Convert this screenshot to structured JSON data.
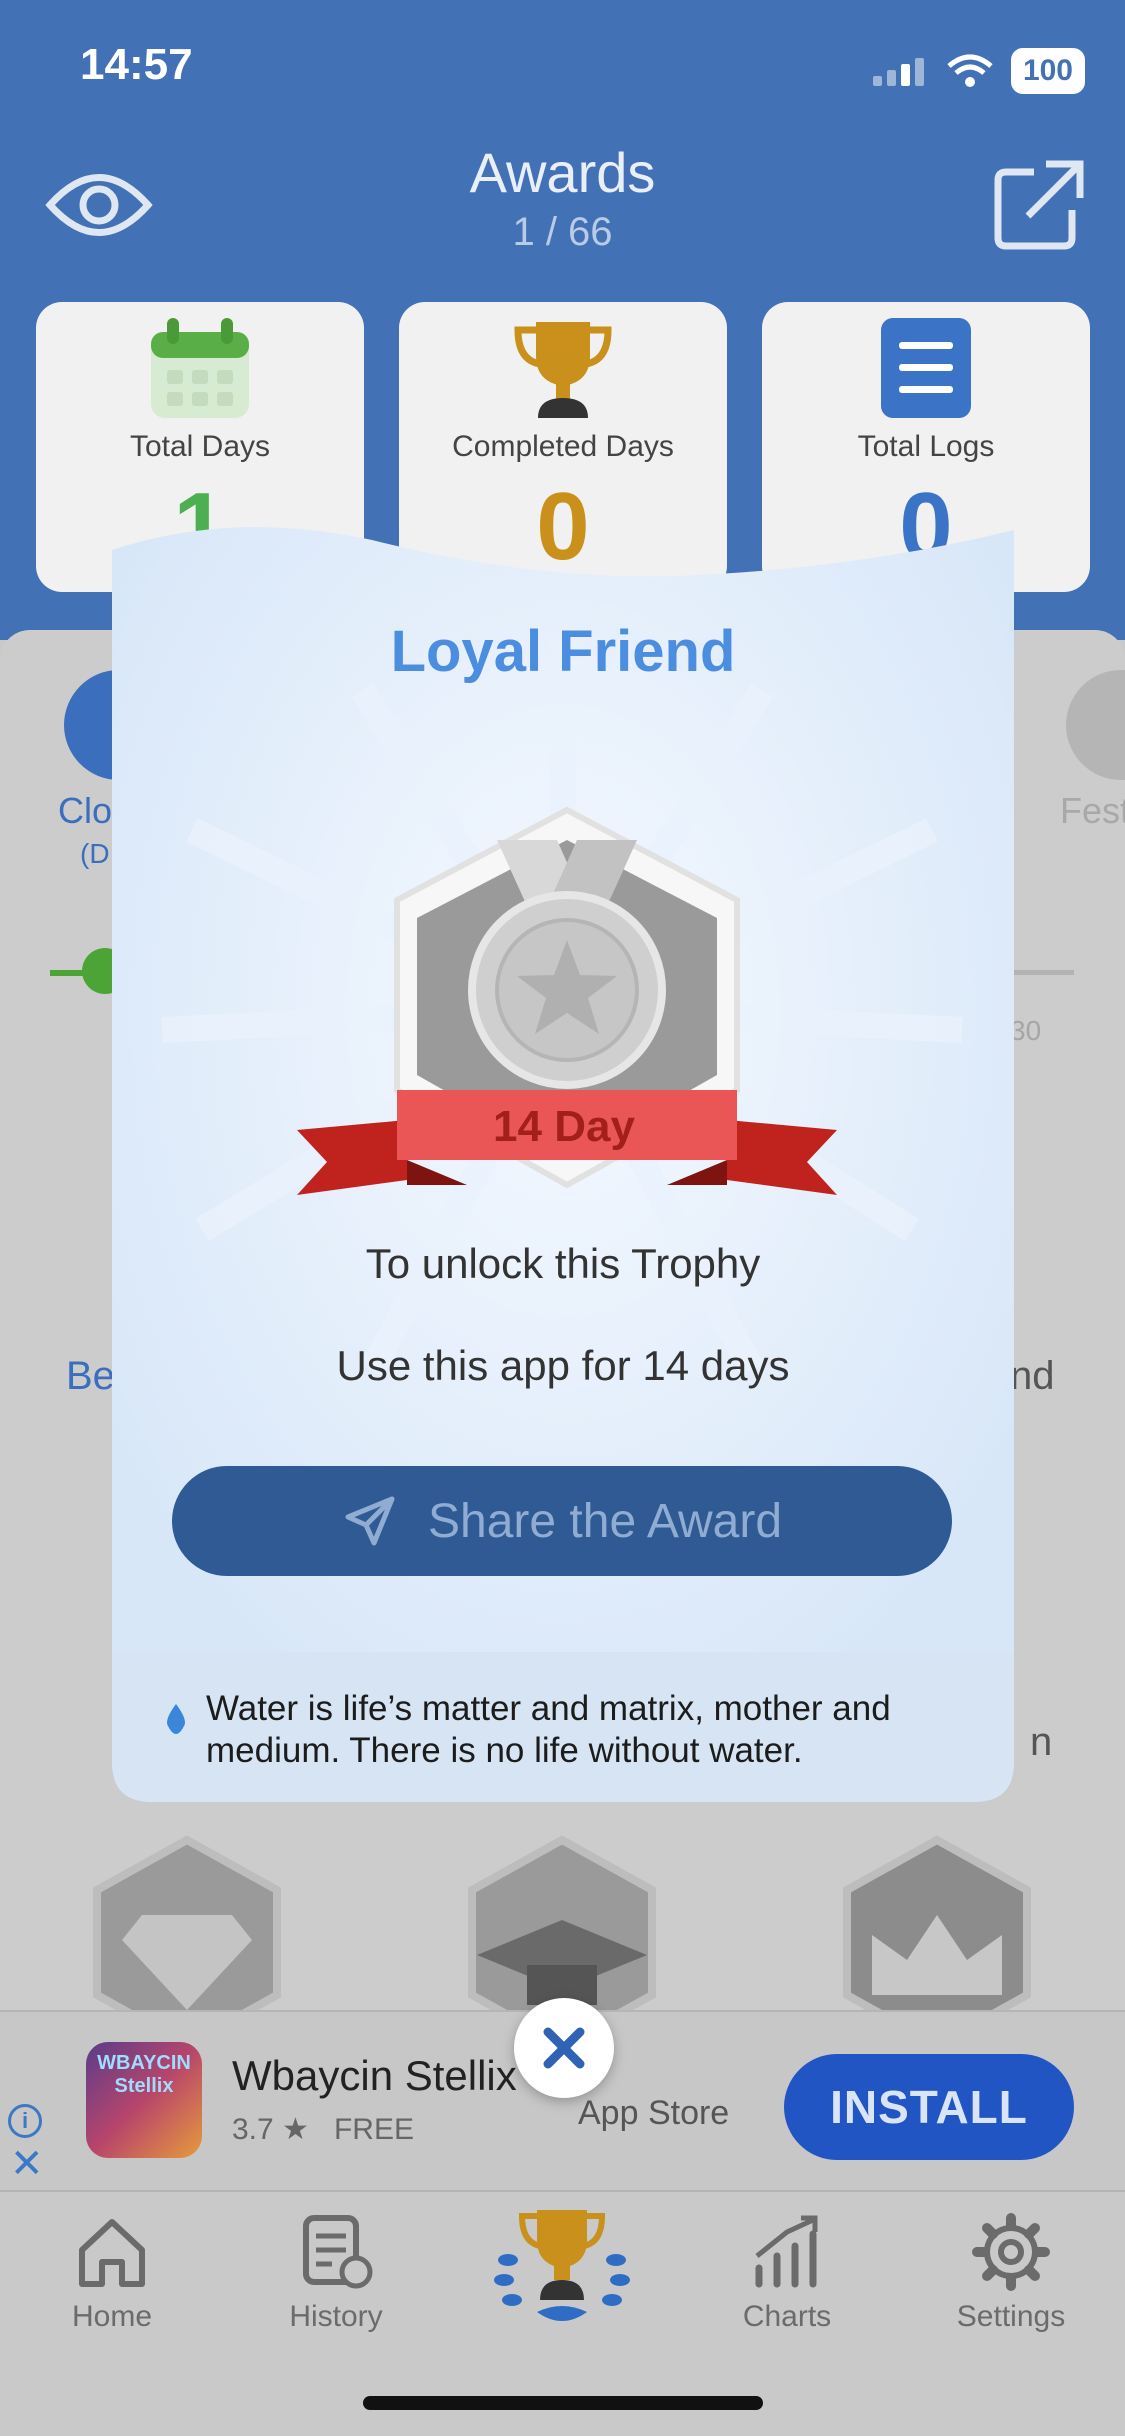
{
  "status_bar": {
    "time": "14:57",
    "battery": "100"
  },
  "header": {
    "title": "Awards",
    "progress": "1 / 66"
  },
  "stats": [
    {
      "label": "Total Days",
      "value": "1",
      "color": "#4caf50",
      "icon": "calendar-icon"
    },
    {
      "label": "Completed Days",
      "value": "0",
      "color": "#c9901c",
      "icon": "trophy-icon"
    },
    {
      "label": "Total Logs",
      "value": "0",
      "color": "#3b74c7",
      "icon": "list-icon"
    }
  ],
  "background": {
    "category_left": "Clo",
    "category_left_sub": "(D",
    "category_right": "Fest",
    "timeline_right": "30",
    "row_left": "Be",
    "row_right": "nd",
    "row2_right": "n"
  },
  "modal": {
    "title": "Loyal Friend",
    "badge_label": "14 Day",
    "unlock_heading": "To unlock this Trophy",
    "unlock_requirement": "Use this app for 14 days",
    "share_label": "Share the Award",
    "quote": "Water is life’s matter and matrix, mother and medium. There is no life without water."
  },
  "ad": {
    "app_name": "Wbaycin Stellix",
    "icon_text": "WBAYCIN Stellix",
    "rating": "3.7 ★",
    "price": "FREE",
    "store": "App Store",
    "install_label": "INSTALL"
  },
  "tabbar": {
    "items": [
      {
        "label": "Home",
        "icon": "home-icon"
      },
      {
        "label": "History",
        "icon": "history-icon"
      },
      {
        "label": "",
        "icon": "trophy-laurel-icon"
      },
      {
        "label": "Charts",
        "icon": "chart-icon"
      },
      {
        "label": "Settings",
        "icon": "gear-icon"
      }
    ]
  },
  "colors": {
    "header_bg": "#4272b5",
    "modal_bg": "#ddeaf9",
    "accent": "#4b8ee0",
    "ribbon": "#e84d4d"
  }
}
